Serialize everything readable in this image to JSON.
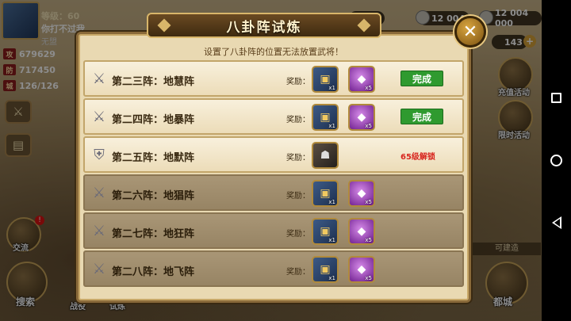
{
  "player": {
    "level": "等级：60",
    "name": "你打不过我",
    "guild": "无盟",
    "stats": [
      {
        "tag": "攻",
        "value": "679629"
      },
      {
        "tag": "防",
        "value": "717450"
      },
      {
        "tag": "城",
        "value": "126/126"
      }
    ]
  },
  "resources": {
    "a": "000",
    "b": "12 004",
    "c": "12 004 000",
    "d": "143"
  },
  "right_menu": {
    "recharge": "充值活动",
    "limited": "限时活动",
    "build_hint": "可建造",
    "capital": "都城"
  },
  "left_menu": {
    "chat": "交流",
    "search": "搜索",
    "battle": "战役",
    "trial": "试炼",
    "chat_badge": "!"
  },
  "modal": {
    "title": "八卦阵试炼",
    "notice": "设置了八卦阵的位置无法放置武将！",
    "close_label": "✕",
    "reward_label": "奖励：",
    "rows": [
      {
        "name": "第二三阵：地慧阵",
        "state": "done",
        "status": "完成",
        "rewards": [
          {
            "kind": "chest",
            "qty": "x1"
          },
          {
            "kind": "gem",
            "qty": "x5"
          }
        ]
      },
      {
        "name": "第二四阵：地暴阵",
        "state": "done",
        "status": "完成",
        "rewards": [
          {
            "kind": "chest",
            "qty": "x1"
          },
          {
            "kind": "gem",
            "qty": "x5"
          }
        ]
      },
      {
        "name": "第二五阵：地默阵",
        "state": "locked",
        "status": "65级解锁",
        "rewards": [
          {
            "kind": "hero",
            "qty": ""
          }
        ]
      },
      {
        "name": "第二六阵：地猖阵",
        "state": "pending",
        "status": "",
        "rewards": [
          {
            "kind": "chest",
            "qty": "x1"
          },
          {
            "kind": "gem",
            "qty": "x5"
          }
        ]
      },
      {
        "name": "第二七阵：地狂阵",
        "state": "pending",
        "status": "",
        "rewards": [
          {
            "kind": "chest",
            "qty": "x1"
          },
          {
            "kind": "gem",
            "qty": "x5"
          }
        ]
      },
      {
        "name": "第二八阵：地飞阵",
        "state": "pending",
        "status": "",
        "rewards": [
          {
            "kind": "chest",
            "qty": "x1"
          },
          {
            "kind": "gem",
            "qty": "x5"
          }
        ]
      }
    ]
  },
  "icons": {
    "row_done": "crossed-swords-icon",
    "row_locked": "helmet-swords-icon",
    "chest": "treasure-chest-icon",
    "gem": "purple-gem-icon",
    "hero": "hero-portrait-icon"
  },
  "colors": {
    "done_button": "#2f9a2f",
    "lock_text": "#d8261f",
    "frame": "#8a6a3a"
  }
}
